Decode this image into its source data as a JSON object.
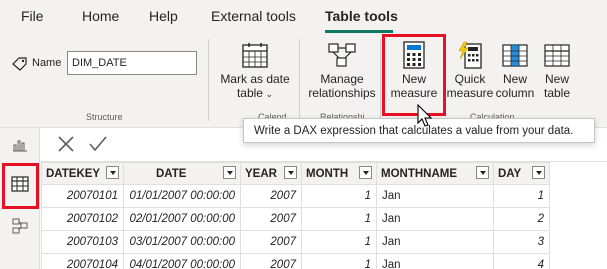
{
  "menu": {
    "items": [
      {
        "label": "File"
      },
      {
        "label": "Home"
      },
      {
        "label": "Help"
      },
      {
        "label": "External tools"
      },
      {
        "label": "Table tools"
      }
    ],
    "active": "Table tools"
  },
  "ribbon": {
    "structure": {
      "name_label": "Name",
      "name_value": "DIM_DATE",
      "group_label": "Structure"
    },
    "calendars": {
      "mark_as_date_line1": "Mark as date",
      "mark_as_date_line2": "table",
      "group_label": "Calend"
    },
    "relationships": {
      "manage_line1": "Manage",
      "manage_line2": "relationships",
      "group_label": "Relationshi"
    },
    "calculations": {
      "new_measure_line1": "New",
      "new_measure_line2": "measure",
      "quick_measure_line1": "Quick",
      "quick_measure_line2": "measure",
      "new_column_line1": "New",
      "new_column_line2": "column",
      "new_table_line1": "New",
      "new_table_line2": "table",
      "group_label": "Calculation"
    }
  },
  "tooltip": {
    "text": "Write a DAX expression that calculates a value from your data."
  },
  "table": {
    "columns": [
      "DATEKEY",
      "DATE",
      "YEAR",
      "MONTH",
      "MONTHNAME",
      "DAY"
    ],
    "rows": [
      [
        "20070101",
        "01/01/2007 00:00:00",
        "2007",
        "1",
        "Jan",
        "1"
      ],
      [
        "20070102",
        "02/01/2007 00:00:00",
        "2007",
        "1",
        "Jan",
        "2"
      ],
      [
        "20070103",
        "03/01/2007 00:00:00",
        "2007",
        "1",
        "Jan",
        "3"
      ],
      [
        "20070104",
        "04/01/2007 00:00:00",
        "2007",
        "1",
        "Jan",
        "4"
      ]
    ]
  },
  "colors": {
    "accent": "#117865",
    "highlight": "#e81123",
    "ribbon_bg": "#f3f2f1"
  }
}
